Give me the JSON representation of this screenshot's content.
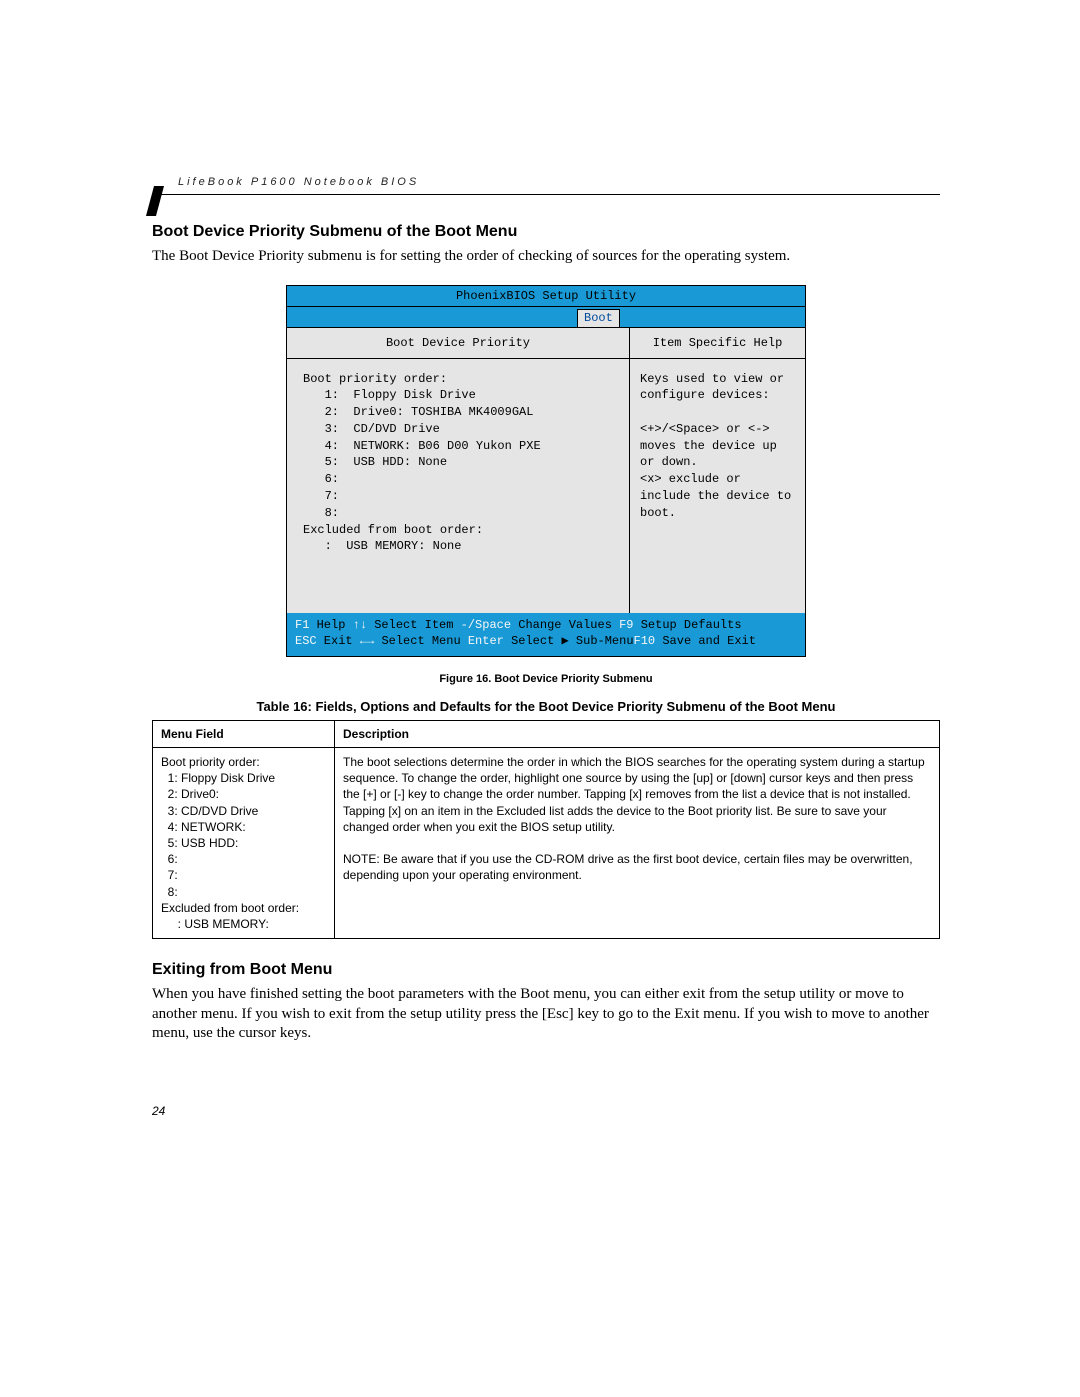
{
  "header": {
    "running": "LifeBook P1600 Notebook BIOS"
  },
  "section1": {
    "title": "Boot Device Priority Submenu of the Boot Menu",
    "paragraph": "The Boot Device Priority submenu is for setting the order of checking of sources for the operating system."
  },
  "bios": {
    "title": "PhoenixBIOS Setup Utility",
    "tab": "Boot",
    "left_header": "Boot Device Priority",
    "right_header": "Item Specific Help",
    "priority_label": "Boot priority order:",
    "items": [
      "1:  Floppy Disk Drive",
      "2:  Drive0: TOSHIBA MK4009GAL",
      "3:  CD/DVD Drive",
      "4:  NETWORK: B06 D00 Yukon PXE",
      "5:  USB HDD: None",
      "6:",
      "7:",
      "8:"
    ],
    "excluded_label": "Excluded from boot order:",
    "excluded_items": [
      ":  USB MEMORY: None"
    ],
    "help_text": "Keys used to view or configure devices:\n\n<+>/<Space> or <-> moves the device up or down.\n<x> exclude or include the device to boot.",
    "footer": {
      "f1": "F1",
      "help": "Help",
      "updown": "↑↓",
      "select_item": "Select Item",
      "minus_space": "-/Space",
      "change_values": "Change Values",
      "f9": "F9",
      "setup_defaults": "Setup Defaults",
      "esc": "ESC",
      "exit": "Exit",
      "leftright": "←→",
      "select_menu": "Select Menu",
      "enter": "Enter",
      "select_sub": "Select ▶ Sub-Menu",
      "f10": "F10",
      "save_exit": "Save and Exit"
    }
  },
  "figure_caption": "Figure 16.  Boot Device Priority Submenu",
  "table_caption": "Table 16: Fields, Options and Defaults for the Boot Device Priority Submenu of the Boot Menu",
  "table": {
    "col1": "Menu Field",
    "col2": "Description",
    "menu_field": "Boot priority order:\n  1: Floppy Disk Drive\n  2: Drive0:\n  3: CD/DVD Drive\n  4: NETWORK:\n  5: USB HDD:\n  6:\n  7:\n  8:\nExcluded from boot order:\n     : USB MEMORY:",
    "description_p1": "The boot selections determine the order in which the BIOS searches for the operating system during a startup sequence. To change the order, highlight one source by using the [up] or [down] cursor keys and then press the [+] or [-] key to change the order number. Tapping [x] removes from the list a device that is not installed. Tapping [x] on an item in the Excluded list adds the device to the Boot priority list. Be sure to save your changed order when you exit the BIOS setup utility.",
    "description_p2": "NOTE: Be aware that if you use the CD-ROM drive as the first boot device, certain files may be overwritten, depending upon your operating environment."
  },
  "section2": {
    "title": "Exiting from Boot Menu",
    "paragraph": "When you have finished setting the boot parameters with the Boot menu, you can either exit from the setup utility or move to another menu. If you wish to exit from the setup utility press the [Esc] key to go to the Exit menu. If you wish to move to another menu, use the cursor keys."
  },
  "page_number": "24"
}
